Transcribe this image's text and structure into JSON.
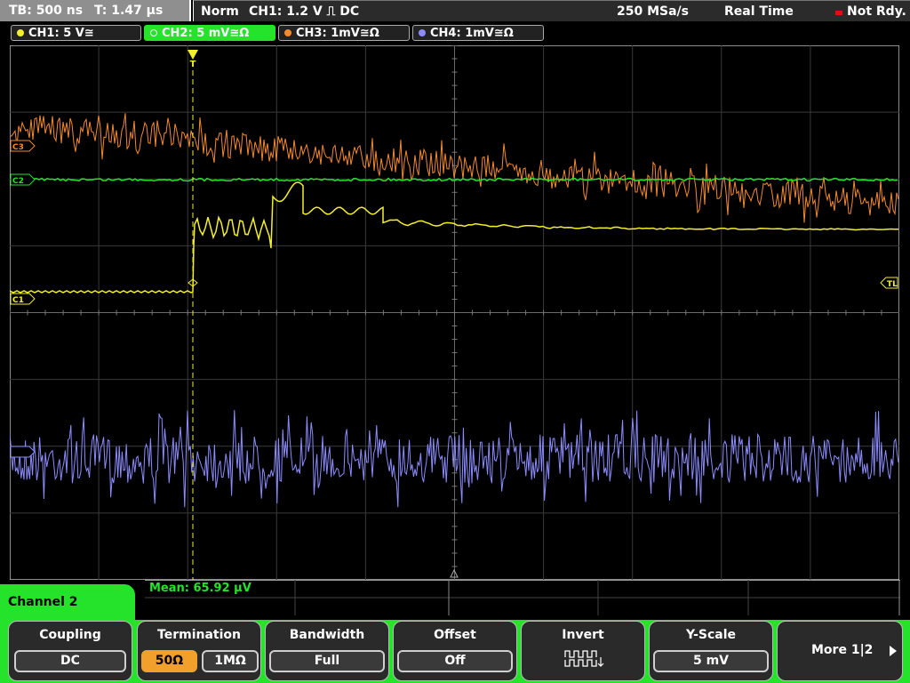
{
  "topbar": {
    "timebase": "TB: 500 ns",
    "trigger_time": "T: 1.47 µs",
    "mode": "Norm",
    "trigger_setting": "CH1: 1.2 V ⎍ DC",
    "sample_rate": "250 MSa/s",
    "acq_mode": "Real Time",
    "status": "Not Rdy."
  },
  "channels": [
    {
      "label": "CH1: 5 V≅",
      "color": "#f3ef2a"
    },
    {
      "label": "CH2: 5 mV≅Ω",
      "color": "#24e32a"
    },
    {
      "label": "CH3: 1mV≅Ω",
      "color": "#f48a2e"
    },
    {
      "label": "CH4: 1mV≅Ω",
      "color": "#8c8cff"
    }
  ],
  "markers": {
    "c3": "C3",
    "c2": "C2",
    "c1": "C1",
    "trigger_level": "TL",
    "trigger_pos": "T"
  },
  "measurement": {
    "label": "Mean: 65.92 µV"
  },
  "softkeys": {
    "menu_title": "Channel 2",
    "coupling": {
      "title": "Coupling",
      "value": "DC"
    },
    "termination": {
      "title": "Termination",
      "opt1": "50Ω",
      "opt2": "1MΩ"
    },
    "bandwidth": {
      "title": "Bandwidth",
      "value": "Full"
    },
    "offset": {
      "title": "Offset",
      "value": "Off"
    },
    "invert": {
      "title": "Invert"
    },
    "yscale": {
      "title": "Y-Scale",
      "value": "5 mV"
    },
    "more": {
      "label": "More 1|2"
    }
  }
}
